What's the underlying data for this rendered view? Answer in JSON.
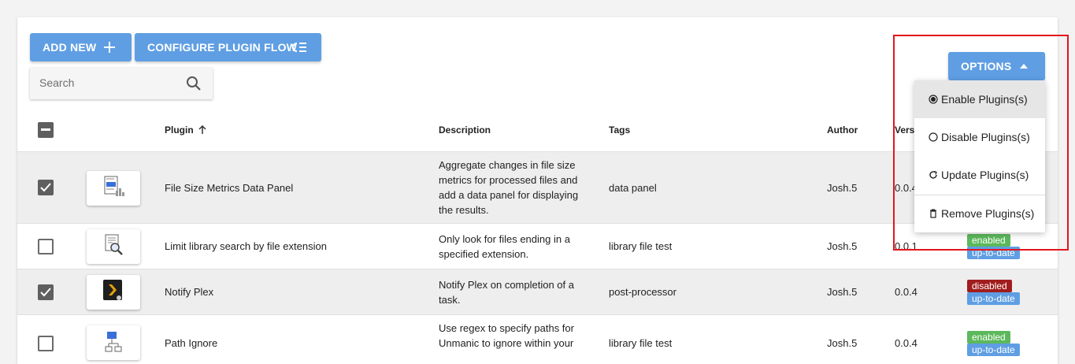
{
  "toolbar": {
    "add_new_label": "ADD NEW",
    "configure_flow_label": "CONFIGURE PLUGIN FLOW",
    "options_label": "OPTIONS"
  },
  "search": {
    "placeholder": "Search"
  },
  "table": {
    "columns": {
      "plugin": "Plugin",
      "description": "Description",
      "tags": "Tags",
      "author": "Author",
      "version": "Vers"
    },
    "rows": [
      {
        "selected": true,
        "name": "File Size Metrics Data Panel",
        "description": [
          "Aggregate changes in file size",
          "metrics for processed files and",
          "add a data panel for displaying",
          "the results."
        ],
        "tags": "data panel",
        "author": "Josh.5",
        "version": "0.0.4",
        "icon": "chart-document-icon",
        "badges": []
      },
      {
        "selected": false,
        "name": "Limit library search by file extension",
        "description": [
          "Only look for files ending in a",
          "specified extension."
        ],
        "tags": "library file test",
        "author": "Josh.5",
        "version": "0.0.1",
        "icon": "file-search-icon",
        "badges": [
          "enabled",
          "up-to-date"
        ]
      },
      {
        "selected": true,
        "name": "Notify Plex",
        "description": [
          "Notify Plex on completion of a",
          "task."
        ],
        "tags": "post-processor",
        "author": "Josh.5",
        "version": "0.0.4",
        "icon": "plex-logo-icon",
        "badges": [
          "disabled",
          "up-to-date"
        ]
      },
      {
        "selected": false,
        "name": "Path Ignore",
        "description": [
          "Use regex to specify paths for",
          "Unmanic to ignore within your"
        ],
        "tags": "library file test",
        "author": "Josh.5",
        "version": "0.0.4",
        "icon": "folder-tree-icon",
        "badges": [
          "enabled",
          "up-to-date"
        ]
      }
    ]
  },
  "options_menu": {
    "items": [
      {
        "label": "Enable Plugins(s)",
        "icon": "radio-checked-icon"
      },
      {
        "label": "Disable Plugins(s)",
        "icon": "radio-unchecked-icon"
      },
      {
        "label": "Update Plugins(s)",
        "icon": "refresh-icon"
      },
      {
        "label": "Remove Plugins(s)",
        "icon": "trash-icon"
      }
    ]
  },
  "colors": {
    "accent": "#5f9ee3",
    "enabled": "#5cb85c",
    "disabled": "#a11d1d",
    "highlight": "#e3161d"
  }
}
